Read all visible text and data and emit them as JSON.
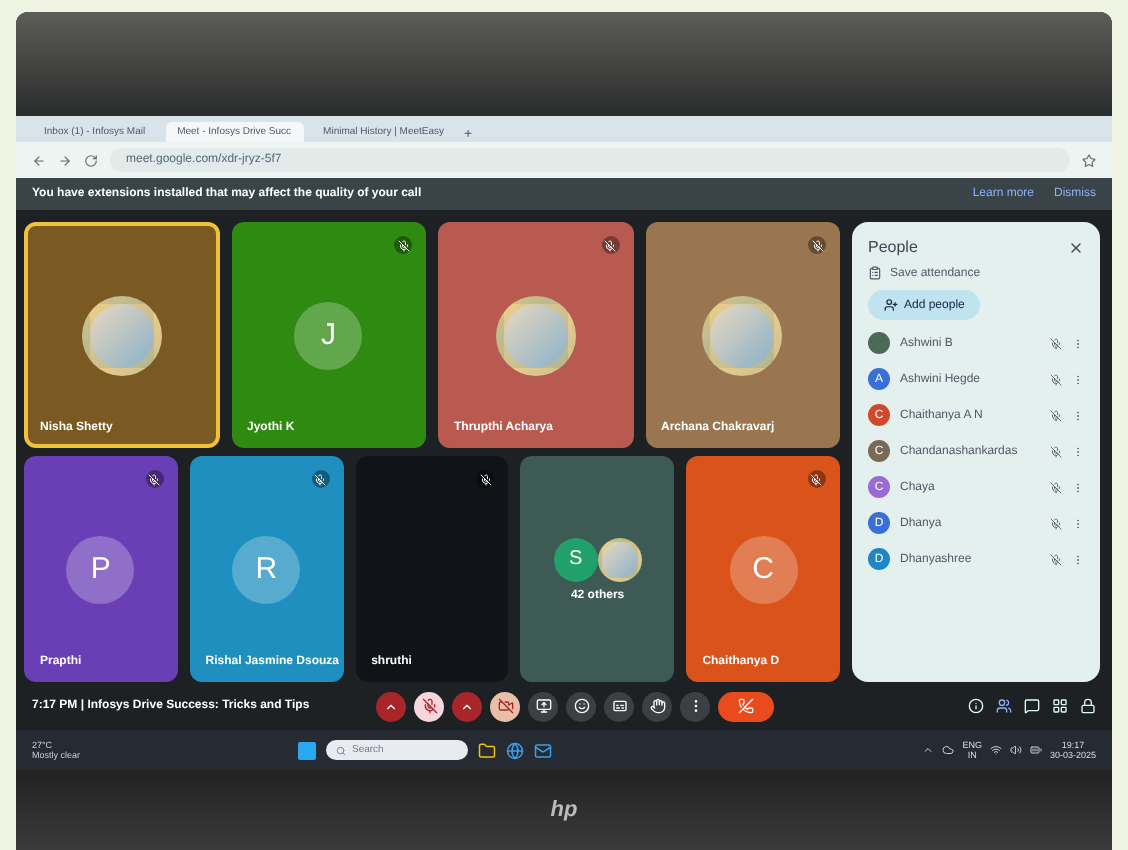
{
  "browser": {
    "tabs": [
      {
        "title": "Inbox (1) - Infosys Mail",
        "selected": false
      },
      {
        "title": "Meet - Infosys Drive Succ",
        "selected": true
      },
      {
        "title": "Minimal History | MeetEasy",
        "selected": false
      }
    ],
    "new_tab": "+",
    "url": "meet.google.com/xdr-jryz-5f7",
    "banner": {
      "text": "You have extensions installed that may affect the quality of your call",
      "learn_more": "Learn more",
      "dismiss": "Dismiss"
    }
  },
  "tiles": [
    [
      {
        "name": "Nisha Shetty",
        "kind": "photo",
        "color": "#7a5a22",
        "speaking": true,
        "muted": false
      },
      {
        "name": "Jyothi K",
        "kind": "initial",
        "initial": "J",
        "color": "#2f8a12",
        "speaking": false,
        "muted": true
      },
      {
        "name": "Thrupthi Acharya",
        "kind": "photo",
        "color": "#b85a50",
        "speaking": false,
        "muted": true
      },
      {
        "name": "Archana Chakravarj",
        "kind": "photo",
        "color": "#9a7650",
        "speaking": false,
        "muted": true
      }
    ],
    [
      {
        "name": "Prapthi",
        "kind": "initial",
        "initial": "P",
        "color": "#6a3fb5",
        "speaking": false,
        "muted": true
      },
      {
        "name": "Rishal Jasmine Dsouza",
        "kind": "initial",
        "initial": "R",
        "color": "#1e8fbf",
        "speaking": false,
        "muted": true
      },
      {
        "name": "shruthi",
        "kind": "empty",
        "color": "#101418",
        "speaking": false,
        "muted": true
      },
      {
        "name": "42 others",
        "kind": "group",
        "initial": "S",
        "color": "#3e5a55",
        "speaking": false,
        "muted": false
      },
      {
        "name": "Chaithanya D",
        "kind": "initial",
        "initial": "C",
        "color": "#d9531a",
        "speaking": false,
        "muted": true
      }
    ]
  ],
  "people": {
    "title": "People",
    "save": "Save attendance",
    "add": "Add people",
    "list": [
      {
        "name": "Ashwini B",
        "color": "#4b6a5a"
      },
      {
        "name": "Ashwini Hegde",
        "initial": "A",
        "color": "#3b6fd8"
      },
      {
        "name": "Chaithanya A N",
        "initial": "C",
        "color": "#d2482a"
      },
      {
        "name": "Chandanashankardas",
        "initial": "C",
        "color": "#7a6a55"
      },
      {
        "name": "Chaya",
        "initial": "C",
        "color": "#9a6ad6"
      },
      {
        "name": "Dhanya",
        "initial": "D",
        "color": "#3b6fd8"
      },
      {
        "name": "Dhanyashree",
        "initial": "D",
        "color": "#1c86c8"
      }
    ]
  },
  "meeting": {
    "time": "7:17 PM",
    "separator": "|",
    "title": "Infosys Drive Success: Tricks and Tips",
    "mic_on": false,
    "camera_on": false
  },
  "taskbar": {
    "temp": "27°C",
    "weather": "Mostly clear",
    "search": "Search",
    "lang": "ENG",
    "region": "IN",
    "clock": "19:17",
    "date": "30-03-2025"
  },
  "brand": "hp"
}
